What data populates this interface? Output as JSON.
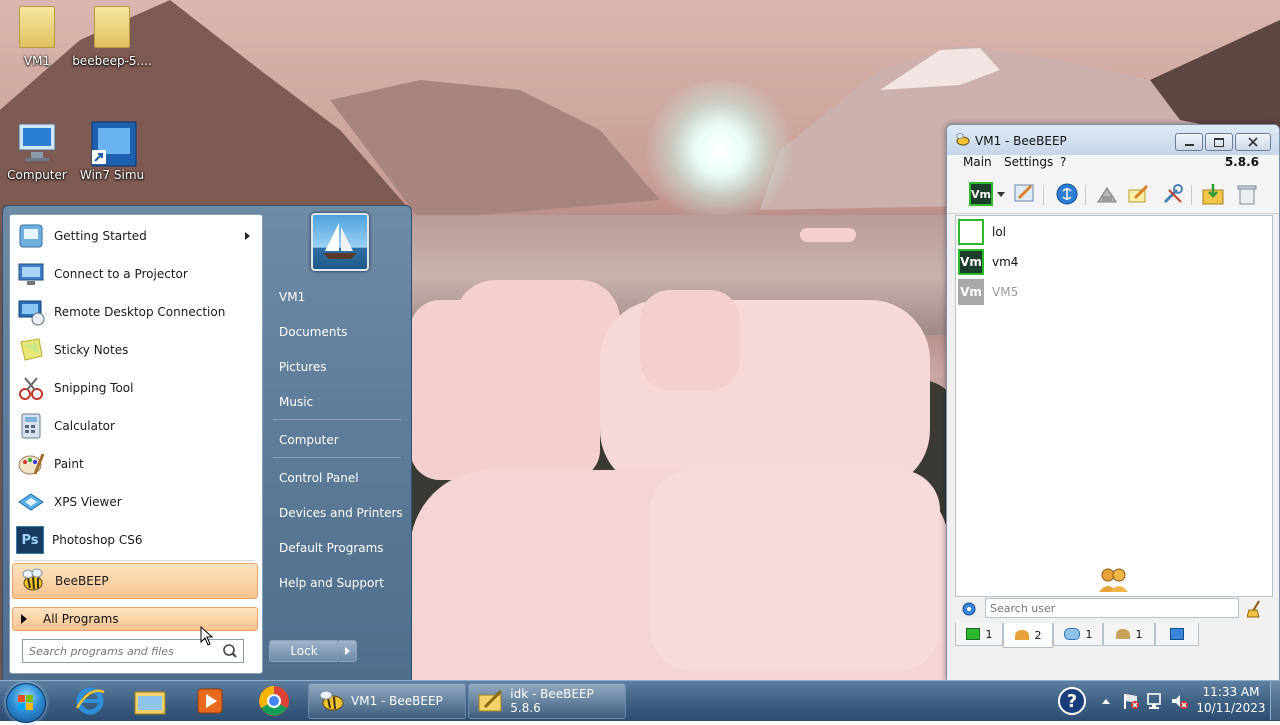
{
  "desktop": {
    "icons": [
      {
        "label": "VM1"
      },
      {
        "label": "beebeep-5...."
      },
      {
        "label": "Computer"
      },
      {
        "label": "Win7 Simu"
      }
    ]
  },
  "start_menu": {
    "programs": [
      {
        "label": "Getting Started",
        "icon": "getting-started-icon"
      },
      {
        "label": "Connect to a Projector",
        "icon": "projector-icon"
      },
      {
        "label": "Remote Desktop Connection",
        "icon": "remote-desktop-icon"
      },
      {
        "label": "Sticky Notes",
        "icon": "sticky-notes-icon"
      },
      {
        "label": "Snipping Tool",
        "icon": "snipping-tool-icon"
      },
      {
        "label": "Calculator",
        "icon": "calculator-icon"
      },
      {
        "label": "Paint",
        "icon": "paint-icon"
      },
      {
        "label": "XPS Viewer",
        "icon": "xps-viewer-icon"
      },
      {
        "label": "Photoshop CS6",
        "icon": "photoshop-icon",
        "glyph": "Ps"
      },
      {
        "label": "BeeBEEP",
        "icon": "beebeep-icon"
      }
    ],
    "all_programs": "All Programs",
    "search_placeholder": "Search programs and files",
    "right_items": [
      "VM1",
      "Documents",
      "Pictures",
      "Music",
      "Computer",
      "Control Panel",
      "Devices and Printers",
      "Default Programs",
      "Help and Support"
    ],
    "lock": "Lock"
  },
  "beebeep": {
    "title": "VM1 - BeeBEEP",
    "menu": [
      "Main",
      "Settings",
      "?"
    ],
    "version": "5.8.6",
    "toolbar_avatar": "Vm",
    "users": [
      {
        "name": "lol",
        "avatar": "",
        "color": "#2eb82e",
        "fill": "#ffffff"
      },
      {
        "name": "vm4",
        "avatar": "Vm",
        "color": "#2eb82e",
        "fill": "#1c3d2a"
      },
      {
        "name": "VM5",
        "avatar": "Vm",
        "color": "#a8a8a8",
        "fill": "#a8a8a8"
      }
    ],
    "search_placeholder": "Search user",
    "tabs": [
      {
        "count": "1",
        "icon": "chat-icon"
      },
      {
        "count": "2",
        "icon": "users-icon"
      },
      {
        "count": "1",
        "icon": "messages-icon"
      },
      {
        "count": "1",
        "icon": "groups-icon"
      },
      {
        "count": "",
        "icon": "file-share-icon"
      }
    ]
  },
  "taskbar": {
    "buttons": [
      {
        "label": "VM1 - BeeBEEP"
      },
      {
        "label": "idk - BeeBEEP 5.8.6"
      }
    ],
    "clock_time": "11:33 AM",
    "clock_date": "10/11/2023",
    "help_glyph": "?"
  },
  "colors": {
    "accent": "#f9c48e",
    "taskbar": "#3e6285",
    "online": "#2eb82e"
  }
}
